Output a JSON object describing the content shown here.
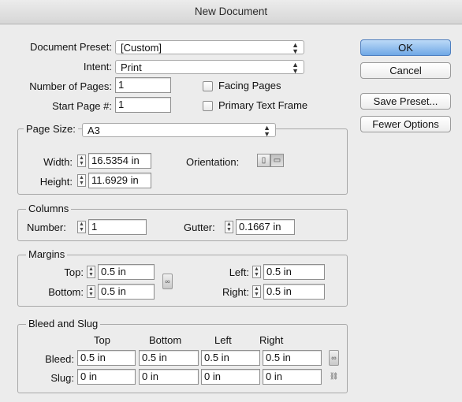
{
  "window": {
    "title": "New Document"
  },
  "preset": {
    "label": "Document Preset:",
    "value": "[Custom]"
  },
  "intent": {
    "label": "Intent:",
    "value": "Print"
  },
  "pages": {
    "number_label": "Number of Pages:",
    "number_value": "1",
    "start_label": "Start Page #:",
    "start_value": "1",
    "facing_label": "Facing Pages",
    "facing_checked": false,
    "primary_label": "Primary Text Frame",
    "primary_checked": false
  },
  "page_size": {
    "label": "Page Size:",
    "value": "A3",
    "width_label": "Width:",
    "width_value": "16.5354 in",
    "height_label": "Height:",
    "height_value": "11.6929 in",
    "orientation_label": "Orientation:",
    "orientation": "landscape"
  },
  "columns": {
    "title": "Columns",
    "number_label": "Number:",
    "number_value": "1",
    "gutter_label": "Gutter:",
    "gutter_value": "0.1667 in"
  },
  "margins": {
    "title": "Margins",
    "top_label": "Top:",
    "top_value": "0.5 in",
    "bottom_label": "Bottom:",
    "bottom_value": "0.5 in",
    "left_label": "Left:",
    "left_value": "0.5 in",
    "right_label": "Right:",
    "right_value": "0.5 in"
  },
  "bleed_slug": {
    "title": "Bleed and Slug",
    "headers": [
      "Top",
      "Bottom",
      "Left",
      "Right"
    ],
    "bleed_label": "Bleed:",
    "bleed": [
      "0.5 in",
      "0.5 in",
      "0.5 in",
      "0.5 in"
    ],
    "slug_label": "Slug:",
    "slug": [
      "0 in",
      "0 in",
      "0 in",
      "0 in"
    ]
  },
  "buttons": {
    "ok": "OK",
    "cancel": "Cancel",
    "save_preset": "Save Preset...",
    "fewer_options": "Fewer Options"
  },
  "colors": {
    "default_button": "#6fa8e6",
    "background": "#ececec"
  }
}
